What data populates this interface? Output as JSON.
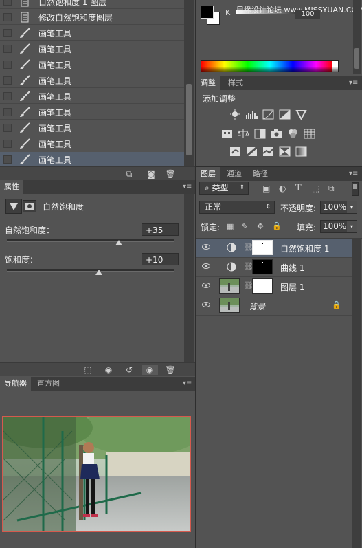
{
  "history": {
    "items": [
      {
        "label": "自然饱和度 1 图层",
        "icon": "document-icon",
        "selected": false
      },
      {
        "label": "修改自然饱和度图层",
        "icon": "document-icon",
        "selected": false
      },
      {
        "label": "画笔工具",
        "icon": "brush-icon",
        "selected": false
      },
      {
        "label": "画笔工具",
        "icon": "brush-icon",
        "selected": false
      },
      {
        "label": "画笔工具",
        "icon": "brush-icon",
        "selected": false
      },
      {
        "label": "画笔工具",
        "icon": "brush-icon",
        "selected": false
      },
      {
        "label": "画笔工具",
        "icon": "brush-icon",
        "selected": false
      },
      {
        "label": "画笔工具",
        "icon": "brush-icon",
        "selected": false
      },
      {
        "label": "画笔工具",
        "icon": "brush-icon",
        "selected": false
      },
      {
        "label": "画笔工具",
        "icon": "brush-icon",
        "selected": false
      },
      {
        "label": "画笔工具",
        "icon": "brush-icon",
        "selected": true
      }
    ]
  },
  "properties": {
    "tab": "属性",
    "title": "自然饱和度",
    "vibrance_label": "自然饱和度：",
    "vibrance_value": "+35",
    "vibrance_fraction": 0.67,
    "saturation_label": "饱和度：",
    "saturation_value": "+10",
    "saturation_fraction": 0.55
  },
  "navigator": {
    "tabs": [
      "导航器",
      "直方图"
    ]
  },
  "color": {
    "channel_label": "K",
    "value": "100",
    "watermark": "思缘设计论坛 www.MISSYUAN.COM"
  },
  "adjustments": {
    "tabs": [
      "调整",
      "样式"
    ],
    "title": "添加调整"
  },
  "layers": {
    "tabs": [
      "图层",
      "通道",
      "路径"
    ],
    "filter_kind": "类型",
    "blend_mode": "正常",
    "opacity_label": "不透明度:",
    "opacity_value": "100%",
    "lock_label": "锁定:",
    "fill_label": "填充:",
    "fill_value": "100%",
    "items": [
      {
        "name": "自然饱和度 1",
        "selected": true
      },
      {
        "name": "曲线 1",
        "selected": false
      },
      {
        "name": "图层 1",
        "selected": false
      },
      {
        "name": "背景",
        "selected": false
      }
    ]
  }
}
